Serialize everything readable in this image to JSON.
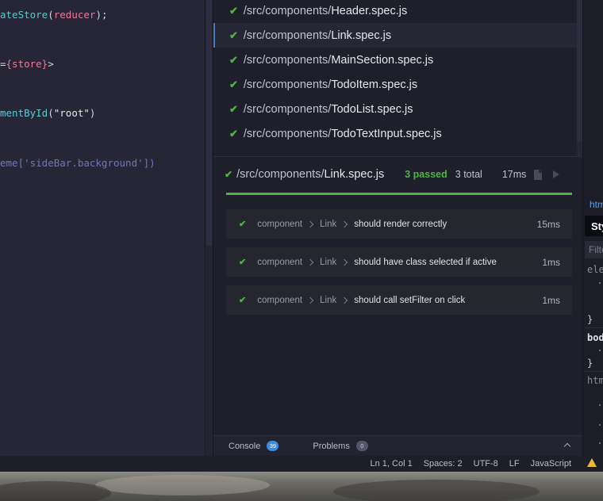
{
  "editor": {
    "lines": [
      {
        "parts": [
          {
            "cls": "tok-fn",
            "text": "ateStore"
          },
          {
            "cls": "tok-punc",
            "text": "("
          },
          {
            "cls": "tok-var",
            "text": "reducer"
          },
          {
            "cls": "tok-punc",
            "text": ");"
          }
        ]
      },
      {
        "parts": [
          {
            "cls": "tok-punc",
            "text": "="
          },
          {
            "cls": "tok-var",
            "text": "{store}"
          },
          {
            "cls": "tok-punc",
            "text": ">"
          }
        ]
      },
      {
        "parts": [
          {
            "cls": "tok-fn",
            "text": "mentById"
          },
          {
            "cls": "tok-punc",
            "text": "("
          },
          {
            "cls": "tok-str",
            "text": "\"root\""
          },
          {
            "cls": "tok-punc",
            "text": ")"
          }
        ]
      },
      {
        "parts": [
          {
            "cls": "tok-comment",
            "text": "eme['sideBar.background'])"
          }
        ]
      }
    ]
  },
  "files": [
    {
      "dir": "/src/components/",
      "file": "Header.spec.js",
      "selected": false
    },
    {
      "dir": "/src/components/",
      "file": "Link.spec.js",
      "selected": true
    },
    {
      "dir": "/src/components/",
      "file": "MainSection.spec.js",
      "selected": false
    },
    {
      "dir": "/src/components/",
      "file": "TodoItem.spec.js",
      "selected": false
    },
    {
      "dir": "/src/components/",
      "file": "TodoList.spec.js",
      "selected": false
    },
    {
      "dir": "/src/components/",
      "file": "TodoTextInput.spec.js",
      "selected": false
    }
  ],
  "detail": {
    "dir": "/src/components/",
    "file": "Link.spec.js",
    "passed": "3 passed",
    "total": "3 total",
    "time": "17ms",
    "progress": 1.0,
    "cases": [
      {
        "crumbs": [
          "component",
          "Link"
        ],
        "name": "should render correctly",
        "time": "15ms"
      },
      {
        "crumbs": [
          "component",
          "Link"
        ],
        "name": "should have class selected if active",
        "time": "1ms"
      },
      {
        "crumbs": [
          "component",
          "Link"
        ],
        "name": "should call setFilter on click",
        "time": "1ms"
      }
    ]
  },
  "bottom_bar": {
    "console_label": "Console",
    "console_count": "39",
    "problems_label": "Problems",
    "problems_count": "0"
  },
  "status": {
    "position": "Ln 1, Col 1",
    "spaces": "Spaces: 2",
    "encoding": "UTF-8",
    "eol": "LF",
    "language": "JavaScript"
  },
  "devtools": {
    "tab": "html",
    "styles": "Styles",
    "filter_placeholder": "Filter",
    "rule1": "element.style",
    "rule2": "body",
    "rule3": "html",
    "open_brace": "{",
    "close_brace": "}"
  },
  "colors": {
    "pass": "#4fb446",
    "accent": "#4b7bbd",
    "console_badge": "#3a8ce0"
  }
}
